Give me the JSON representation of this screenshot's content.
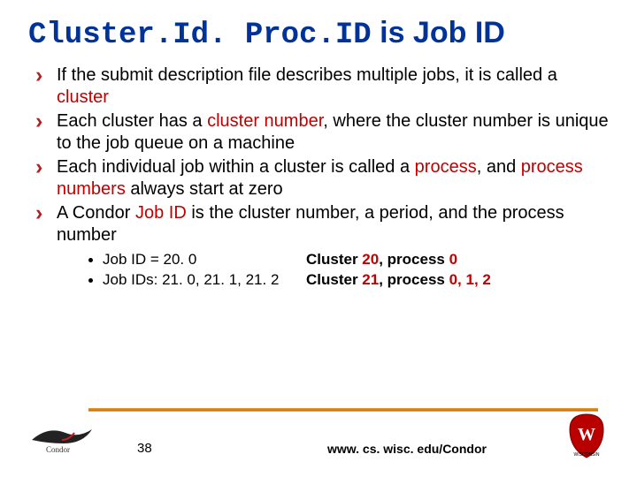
{
  "title": {
    "mono": "Cluster.Id. Proc.ID",
    "rest": " is Job ID"
  },
  "bullets": [
    {
      "pre": "If the submit description file describes multiple jobs, it is called a ",
      "red": "cluster",
      "post": ""
    },
    {
      "pre": "Each cluster has a ",
      "red": "cluster number",
      "post": ", where the cluster number is unique to the job queue on a machine"
    },
    {
      "pre": "Each individual job within a cluster is called a ",
      "red": "process",
      "mid": ", and ",
      "red2": "process numbers",
      "post": " always start at zero"
    },
    {
      "pre": "A Condor ",
      "red": "Job ID",
      "post": " is the cluster number, a period, and the process number"
    }
  ],
  "sub": [
    {
      "c1": "Job ID = 20. 0",
      "c2a": "Cluster ",
      "c2r1": "20",
      "c2b": ", process ",
      "c2r2": "0"
    },
    {
      "c1": "Job IDs: 21. 0, 21. 1, 21. 2",
      "c2a": "Cluster ",
      "c2r1": "21",
      "c2b": ", process ",
      "c2r2": "0, 1, 2"
    }
  ],
  "footer": {
    "page": "38",
    "url": "www. cs. wisc. edu/Condor",
    "condor_alt": "condor-logo",
    "wisc_alt": "wisconsin-logo"
  }
}
